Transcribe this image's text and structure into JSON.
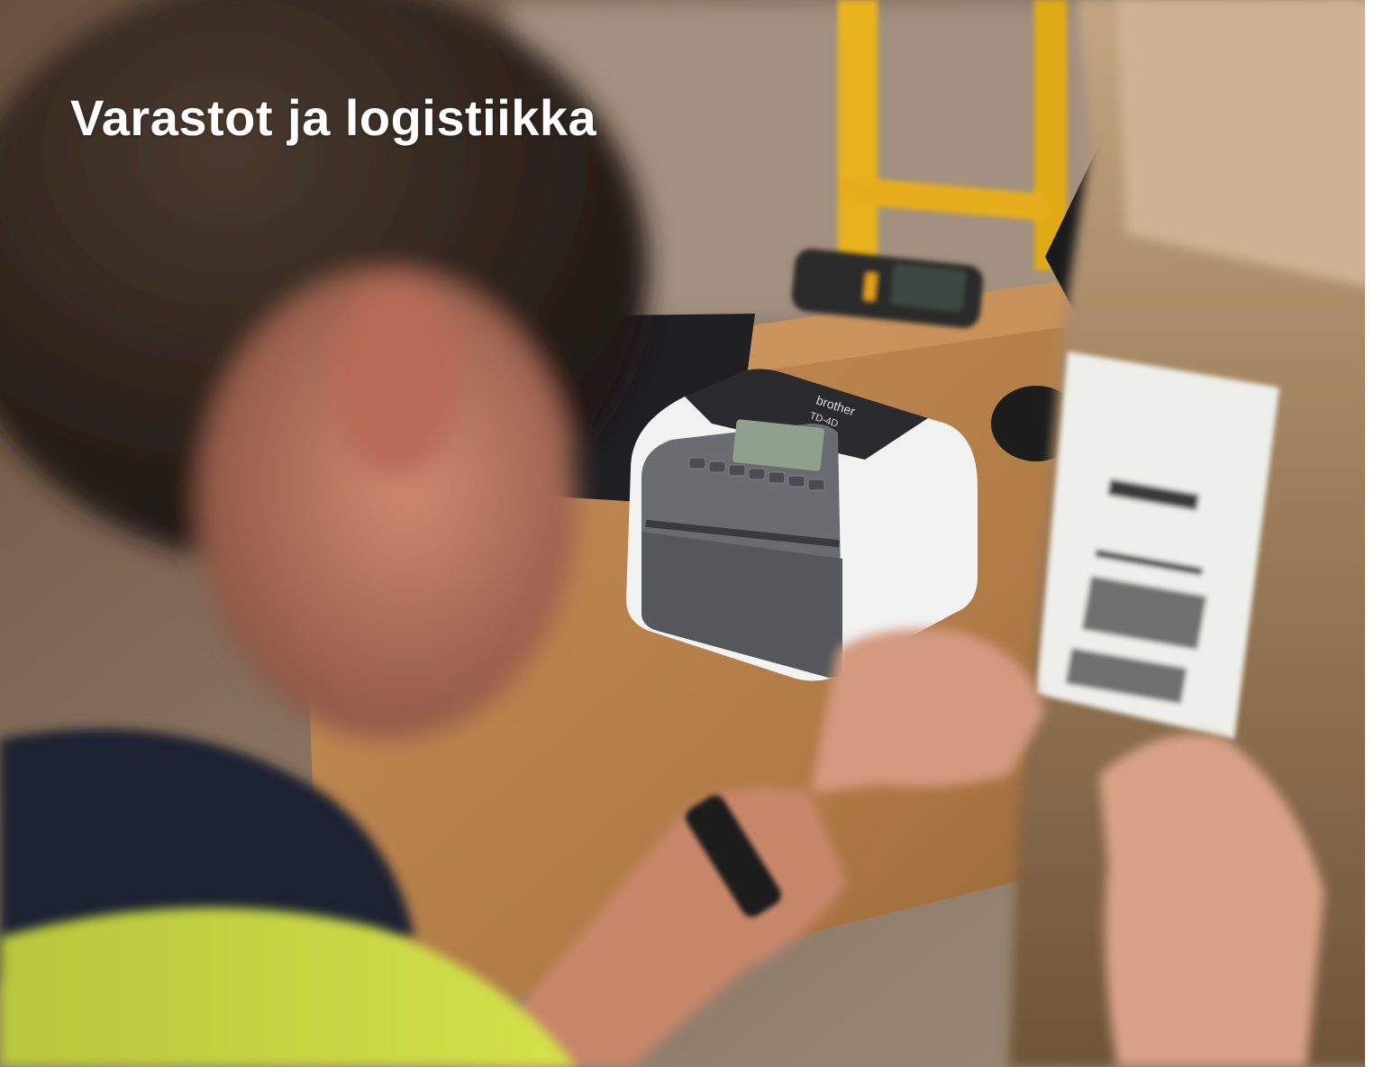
{
  "hero": {
    "title": "Varastot ja logistiikka",
    "accent_color": "#6e7a2e"
  },
  "printer": {
    "brand": "brother",
    "model": "TD-4D"
  }
}
